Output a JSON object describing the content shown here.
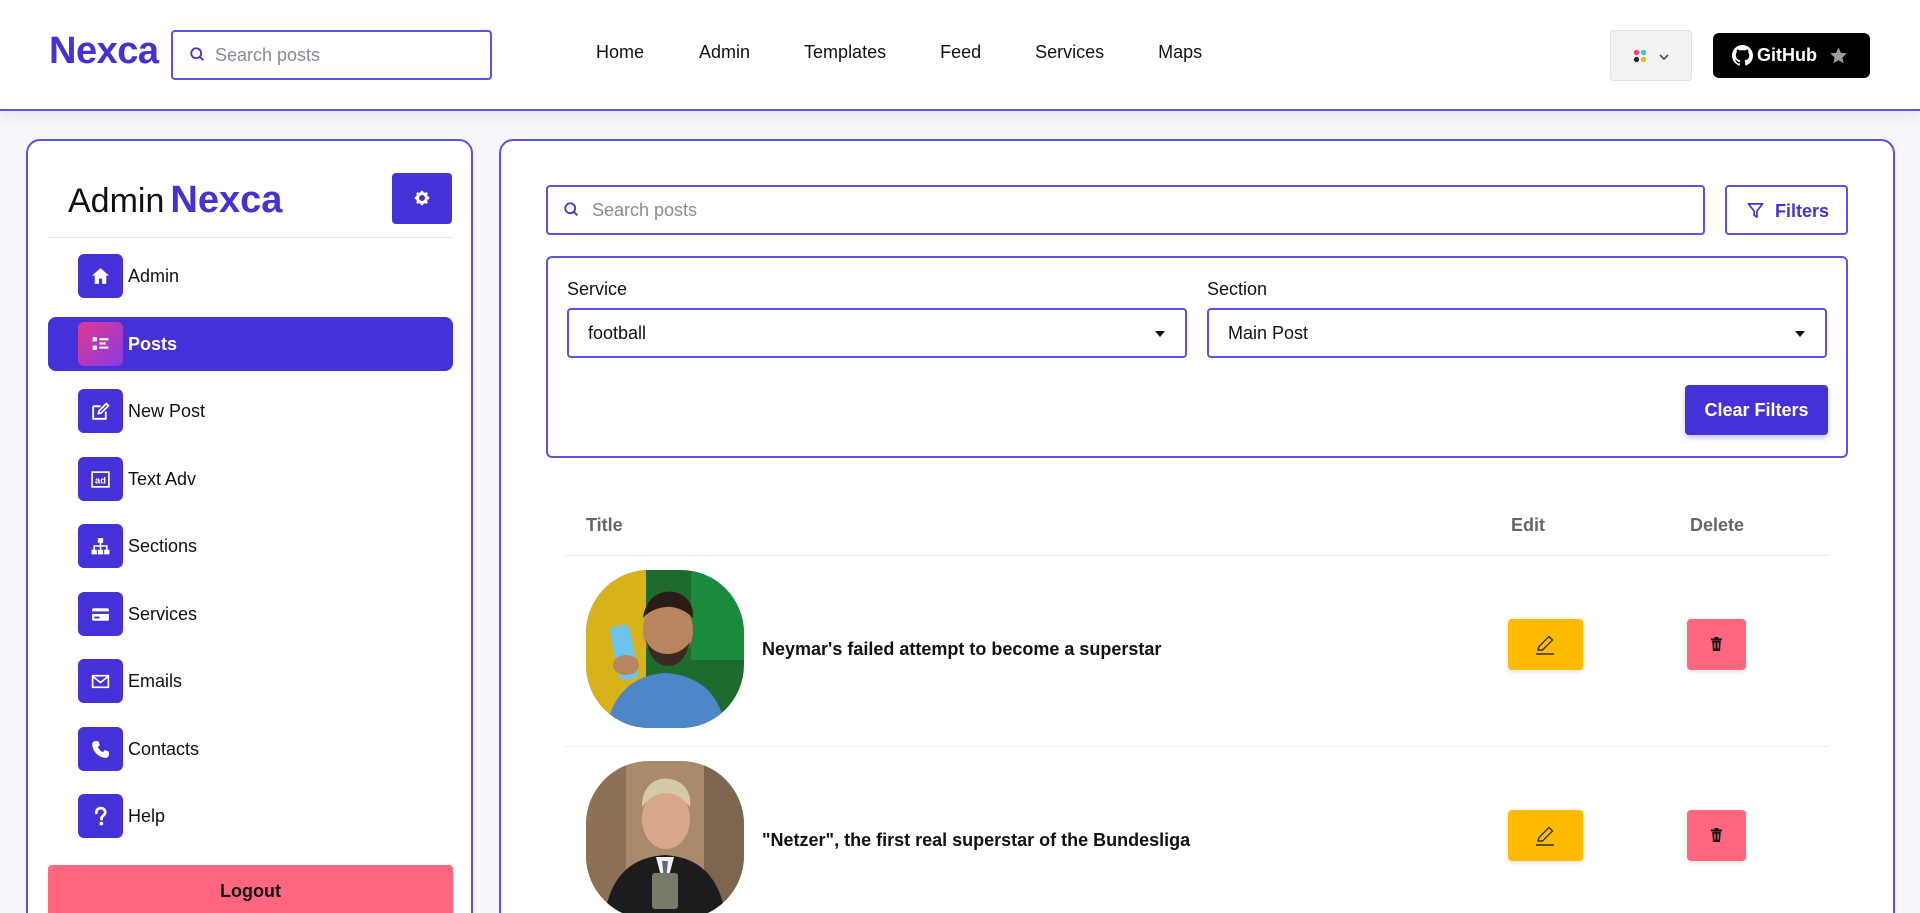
{
  "header": {
    "brand": "Nexca",
    "search_placeholder": "Search posts",
    "nav": [
      "Home",
      "Admin",
      "Templates",
      "Feed",
      "Services",
      "Maps"
    ],
    "github_label": "GitHub"
  },
  "sidebar": {
    "title_prefix": "Admin",
    "title_accent": "Nexca",
    "items": [
      {
        "label": "Admin",
        "icon": "home-icon"
      },
      {
        "label": "Posts",
        "icon": "list-icon"
      },
      {
        "label": "New Post",
        "icon": "edit-icon"
      },
      {
        "label": "Text Adv",
        "icon": "ad-icon"
      },
      {
        "label": "Sections",
        "icon": "sitemap-icon"
      },
      {
        "label": "Services",
        "icon": "card-icon"
      },
      {
        "label": "Emails",
        "icon": "mail-icon"
      },
      {
        "label": "Contacts",
        "icon": "phone-icon"
      },
      {
        "label": "Help",
        "icon": "question-icon"
      }
    ],
    "active_item": "Posts",
    "logout_label": "Logout"
  },
  "main": {
    "search_placeholder": "Search posts",
    "filters_label": "Filters",
    "service_label": "Service",
    "service_value": "football",
    "section_label": "Section",
    "section_value": "Main Post",
    "clear_label": "Clear Filters",
    "columns": {
      "title": "Title",
      "edit": "Edit",
      "delete": "Delete"
    },
    "posts": [
      {
        "title": "Neymar's failed attempt to become a superstar"
      },
      {
        "title": "\"Netzer\", the first real superstar of the Bundesliga"
      }
    ]
  },
  "colors": {
    "accent": "#4432d8",
    "edit": "#ffbb00",
    "delete": "#ff6680"
  }
}
